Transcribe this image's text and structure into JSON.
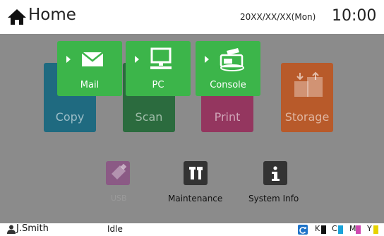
{
  "header": {
    "title": "Home",
    "date": "20XX/XX/XX(Mon)",
    "time": "10:00"
  },
  "tiles": {
    "copy": "Copy",
    "scan": "Scan",
    "print": "Print",
    "storage": "Storage"
  },
  "popup": {
    "mail": "Mail",
    "pc": "PC",
    "console": "Console"
  },
  "tools": {
    "usb": "USB",
    "maintenance": "Maintenance",
    "system_info": "System Info"
  },
  "status": {
    "user": "J.Smith",
    "state": "Idle",
    "inks": [
      {
        "label": "K",
        "color": "#111111"
      },
      {
        "label": "C",
        "color": "#1aa3d9"
      },
      {
        "label": "M",
        "color": "#d048b0"
      },
      {
        "label": "Y",
        "color": "#e6d200"
      }
    ]
  },
  "colors": {
    "green": "#3cb54a",
    "main_dim": "#8b8b8b"
  },
  "icons": {
    "home": "home-icon",
    "mail": "envelope-icon",
    "pc": "monitor-icon",
    "console": "scanner-icon",
    "user": "user-icon",
    "refresh": "refresh-icon"
  }
}
